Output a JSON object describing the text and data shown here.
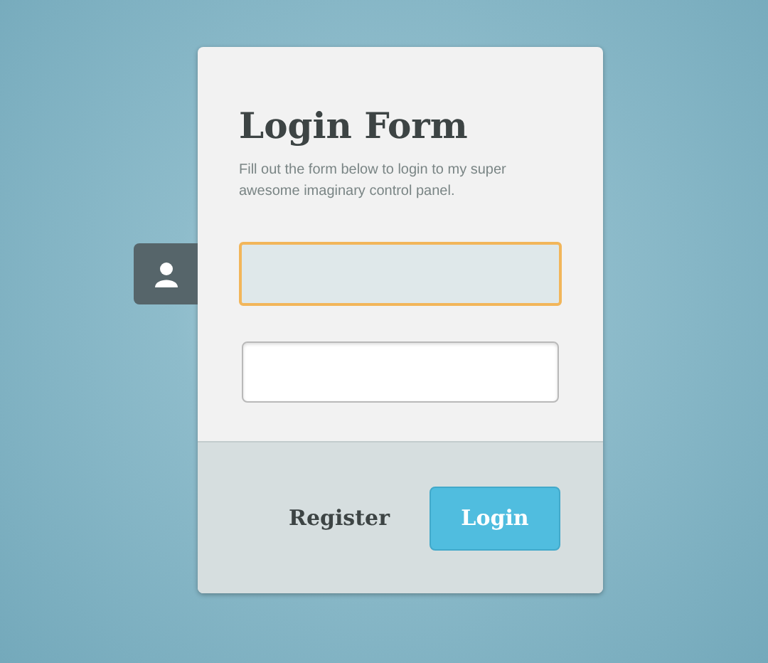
{
  "form": {
    "title": "Login Form",
    "description": "Fill out the form below to login to my super awesome imaginary control panel."
  },
  "fields": [
    {
      "focused": true
    },
    {
      "focused": false
    }
  ],
  "actions": [
    {
      "kind": "link",
      "label": "Register"
    },
    {
      "kind": "primary",
      "label": "Login"
    }
  ]
}
